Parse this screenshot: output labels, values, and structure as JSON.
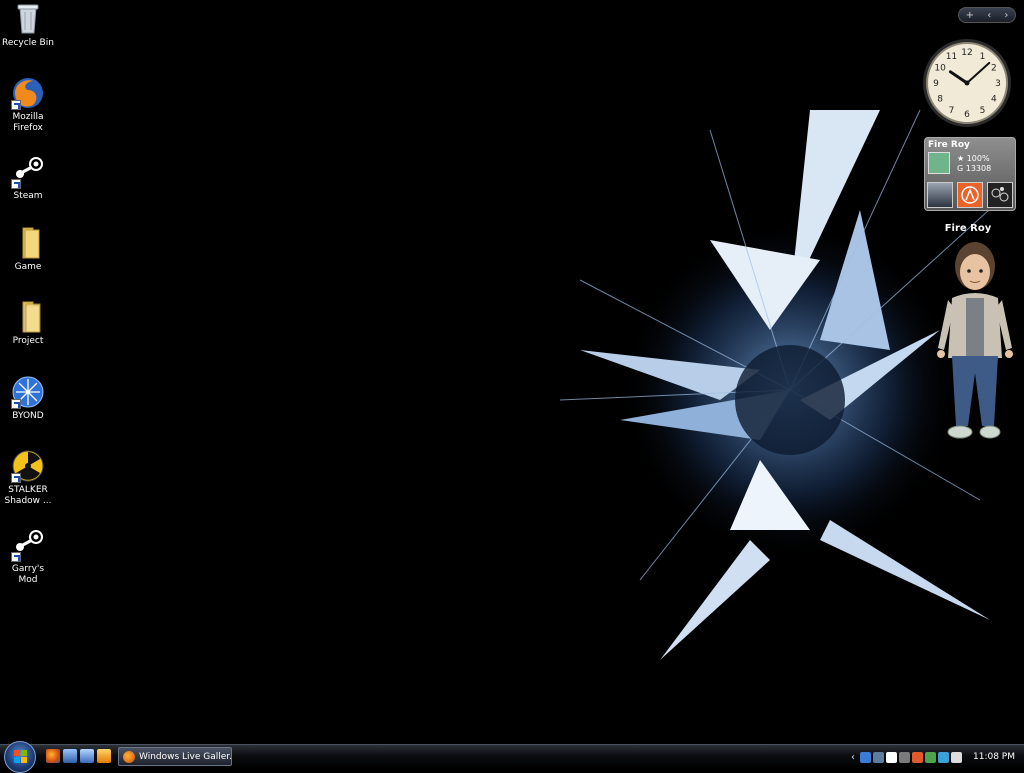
{
  "desktop": {
    "icons": [
      {
        "label_1": "Recycle Bin",
        "label_2": "",
        "icon": "recycle-bin-icon"
      },
      {
        "label_1": "Mozilla",
        "label_2": "Firefox",
        "icon": "firefox-icon"
      },
      {
        "label_1": "Steam",
        "label_2": "",
        "icon": "steam-icon"
      },
      {
        "label_1": "Game",
        "label_2": "",
        "icon": "folder-icon"
      },
      {
        "label_1": "Project",
        "label_2": "",
        "icon": "folder-icon"
      },
      {
        "label_1": "BYOND",
        "label_2": "",
        "icon": "byond-icon"
      },
      {
        "label_1": "STALKER",
        "label_2": "Shadow ...",
        "icon": "radiation-icon"
      },
      {
        "label_1": "Garry's Mod",
        "label_2": "",
        "icon": "steam-icon"
      }
    ]
  },
  "sidebar": {
    "control_add": "+",
    "control_prev": "‹",
    "control_next": "›",
    "clock": {
      "hour": 10,
      "minute": 8,
      "numerals": [
        "12",
        "1",
        "2",
        "3",
        "4",
        "5",
        "6",
        "7",
        "8",
        "9",
        "10",
        "11"
      ]
    },
    "xbox_card": {
      "gamertag": "Fire Roy",
      "rep_symbol": "★",
      "rep_value": "100%",
      "gamerscore_symbol": "G",
      "gamerscore_value": "13308"
    },
    "avatar_name": "Fire Roy"
  },
  "taskbar": {
    "active_window": "Windows Live Galler...",
    "tray_chevron": "‹",
    "time": "11:08 PM"
  },
  "colors": {
    "accent": "#1d4fb8",
    "taskbar_top": "#2b3038",
    "wallpaper_highlight": "#cfe3f7"
  }
}
